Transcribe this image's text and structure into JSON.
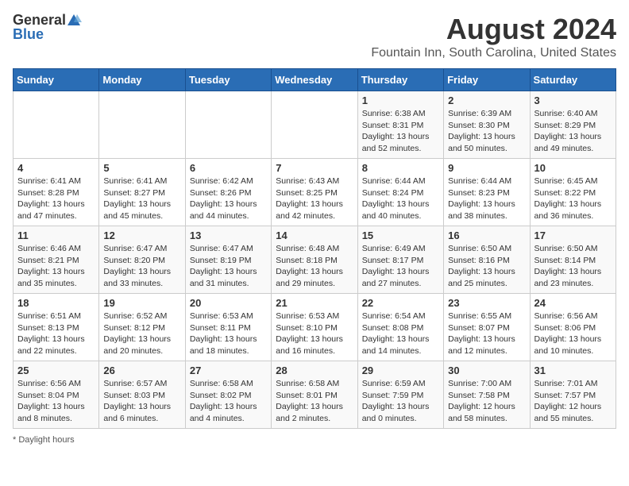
{
  "header": {
    "logo_general": "General",
    "logo_blue": "Blue",
    "title": "August 2024",
    "subtitle": "Fountain Inn, South Carolina, United States"
  },
  "calendar": {
    "days_of_week": [
      "Sunday",
      "Monday",
      "Tuesday",
      "Wednesday",
      "Thursday",
      "Friday",
      "Saturday"
    ],
    "weeks": [
      [
        {
          "day": "",
          "info": ""
        },
        {
          "day": "",
          "info": ""
        },
        {
          "day": "",
          "info": ""
        },
        {
          "day": "",
          "info": ""
        },
        {
          "day": "1",
          "info": "Sunrise: 6:38 AM\nSunset: 8:31 PM\nDaylight: 13 hours\nand 52 minutes."
        },
        {
          "day": "2",
          "info": "Sunrise: 6:39 AM\nSunset: 8:30 PM\nDaylight: 13 hours\nand 50 minutes."
        },
        {
          "day": "3",
          "info": "Sunrise: 6:40 AM\nSunset: 8:29 PM\nDaylight: 13 hours\nand 49 minutes."
        }
      ],
      [
        {
          "day": "4",
          "info": "Sunrise: 6:41 AM\nSunset: 8:28 PM\nDaylight: 13 hours\nand 47 minutes."
        },
        {
          "day": "5",
          "info": "Sunrise: 6:41 AM\nSunset: 8:27 PM\nDaylight: 13 hours\nand 45 minutes."
        },
        {
          "day": "6",
          "info": "Sunrise: 6:42 AM\nSunset: 8:26 PM\nDaylight: 13 hours\nand 44 minutes."
        },
        {
          "day": "7",
          "info": "Sunrise: 6:43 AM\nSunset: 8:25 PM\nDaylight: 13 hours\nand 42 minutes."
        },
        {
          "day": "8",
          "info": "Sunrise: 6:44 AM\nSunset: 8:24 PM\nDaylight: 13 hours\nand 40 minutes."
        },
        {
          "day": "9",
          "info": "Sunrise: 6:44 AM\nSunset: 8:23 PM\nDaylight: 13 hours\nand 38 minutes."
        },
        {
          "day": "10",
          "info": "Sunrise: 6:45 AM\nSunset: 8:22 PM\nDaylight: 13 hours\nand 36 minutes."
        }
      ],
      [
        {
          "day": "11",
          "info": "Sunrise: 6:46 AM\nSunset: 8:21 PM\nDaylight: 13 hours\nand 35 minutes."
        },
        {
          "day": "12",
          "info": "Sunrise: 6:47 AM\nSunset: 8:20 PM\nDaylight: 13 hours\nand 33 minutes."
        },
        {
          "day": "13",
          "info": "Sunrise: 6:47 AM\nSunset: 8:19 PM\nDaylight: 13 hours\nand 31 minutes."
        },
        {
          "day": "14",
          "info": "Sunrise: 6:48 AM\nSunset: 8:18 PM\nDaylight: 13 hours\nand 29 minutes."
        },
        {
          "day": "15",
          "info": "Sunrise: 6:49 AM\nSunset: 8:17 PM\nDaylight: 13 hours\nand 27 minutes."
        },
        {
          "day": "16",
          "info": "Sunrise: 6:50 AM\nSunset: 8:16 PM\nDaylight: 13 hours\nand 25 minutes."
        },
        {
          "day": "17",
          "info": "Sunrise: 6:50 AM\nSunset: 8:14 PM\nDaylight: 13 hours\nand 23 minutes."
        }
      ],
      [
        {
          "day": "18",
          "info": "Sunrise: 6:51 AM\nSunset: 8:13 PM\nDaylight: 13 hours\nand 22 minutes."
        },
        {
          "day": "19",
          "info": "Sunrise: 6:52 AM\nSunset: 8:12 PM\nDaylight: 13 hours\nand 20 minutes."
        },
        {
          "day": "20",
          "info": "Sunrise: 6:53 AM\nSunset: 8:11 PM\nDaylight: 13 hours\nand 18 minutes."
        },
        {
          "day": "21",
          "info": "Sunrise: 6:53 AM\nSunset: 8:10 PM\nDaylight: 13 hours\nand 16 minutes."
        },
        {
          "day": "22",
          "info": "Sunrise: 6:54 AM\nSunset: 8:08 PM\nDaylight: 13 hours\nand 14 minutes."
        },
        {
          "day": "23",
          "info": "Sunrise: 6:55 AM\nSunset: 8:07 PM\nDaylight: 13 hours\nand 12 minutes."
        },
        {
          "day": "24",
          "info": "Sunrise: 6:56 AM\nSunset: 8:06 PM\nDaylight: 13 hours\nand 10 minutes."
        }
      ],
      [
        {
          "day": "25",
          "info": "Sunrise: 6:56 AM\nSunset: 8:04 PM\nDaylight: 13 hours\nand 8 minutes."
        },
        {
          "day": "26",
          "info": "Sunrise: 6:57 AM\nSunset: 8:03 PM\nDaylight: 13 hours\nand 6 minutes."
        },
        {
          "day": "27",
          "info": "Sunrise: 6:58 AM\nSunset: 8:02 PM\nDaylight: 13 hours\nand 4 minutes."
        },
        {
          "day": "28",
          "info": "Sunrise: 6:58 AM\nSunset: 8:01 PM\nDaylight: 13 hours\nand 2 minutes."
        },
        {
          "day": "29",
          "info": "Sunrise: 6:59 AM\nSunset: 7:59 PM\nDaylight: 13 hours\nand 0 minutes."
        },
        {
          "day": "30",
          "info": "Sunrise: 7:00 AM\nSunset: 7:58 PM\nDaylight: 12 hours\nand 58 minutes."
        },
        {
          "day": "31",
          "info": "Sunrise: 7:01 AM\nSunset: 7:57 PM\nDaylight: 12 hours\nand 55 minutes."
        }
      ]
    ]
  },
  "footer": {
    "note": "Daylight hours"
  }
}
